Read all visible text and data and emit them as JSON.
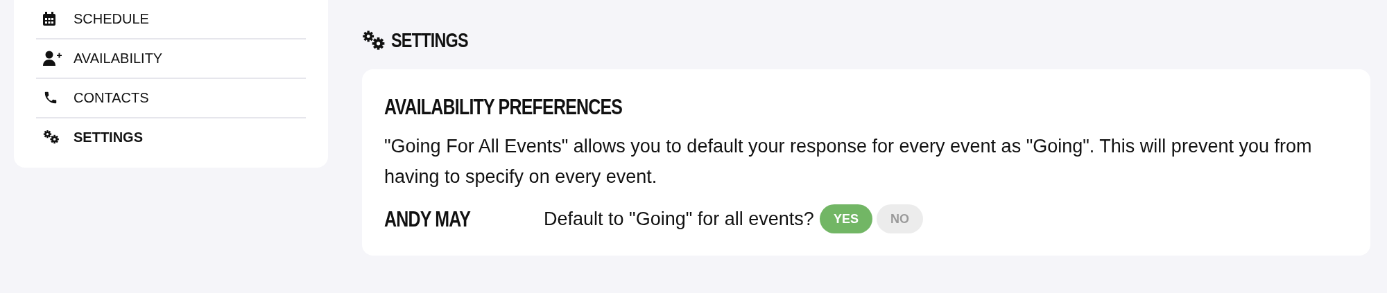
{
  "sidebar": {
    "items": [
      {
        "label": "SCHEDULE",
        "selected": false
      },
      {
        "label": "AVAILABILITY",
        "selected": false
      },
      {
        "label": "CONTACTS",
        "selected": false
      },
      {
        "label": "SETTINGS",
        "selected": true
      }
    ]
  },
  "page": {
    "title": "SETTINGS"
  },
  "card": {
    "title": "AVAILABILITY PREFERENCES",
    "description": "\"Going For All Events\" allows you to default your response for every event as \"Going\". This will prevent you from having to specify on every event.",
    "rows": [
      {
        "name": "ANDY MAY",
        "question": "Default to \"Going\" for all events?",
        "options": [
          {
            "label": "YES",
            "selected": true
          },
          {
            "label": "NO",
            "selected": false
          }
        ]
      }
    ]
  }
}
